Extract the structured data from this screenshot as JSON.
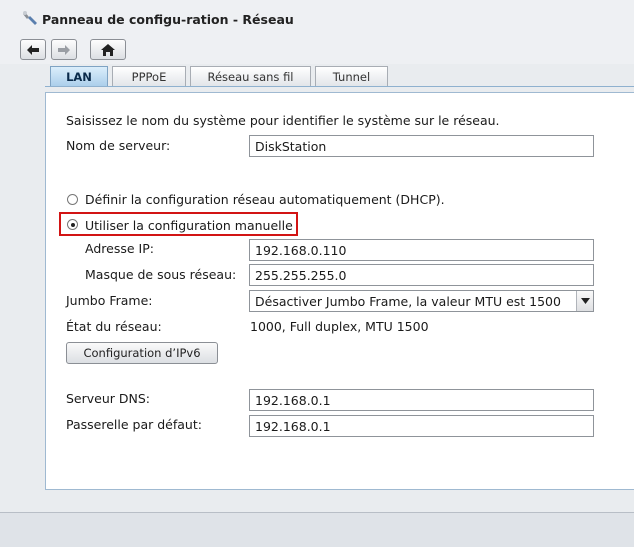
{
  "window": {
    "title": "Panneau de configu-ration - Réseau"
  },
  "nav": {
    "back_icon": "arrow-left-icon",
    "forward_icon": "arrow-right-icon",
    "home_icon": "home-icon"
  },
  "tabs": [
    {
      "label": "LAN",
      "active": true
    },
    {
      "label": "PPPoE",
      "active": false
    },
    {
      "label": "Réseau sans fil",
      "active": false
    },
    {
      "label": "Tunnel",
      "active": false
    }
  ],
  "form": {
    "intro": "Saisissez le nom du système pour identifier le système sur le réseau.",
    "server_name_label": "Nom de serveur:",
    "server_name_value": "DiskStation",
    "dhcp_label": "Définir la configuration réseau automatiquement (DHCP).",
    "manual_label": "Utiliser la configuration manuelle",
    "ip_label": "Adresse IP:",
    "ip_value": "192.168.0.110",
    "mask_label": "Masque de sous réseau:",
    "mask_value": "255.255.255.0",
    "jumbo_label": "Jumbo Frame:",
    "jumbo_value": "Désactiver Jumbo Frame, la valeur MTU est 1500",
    "status_label": "État du réseau:",
    "status_value": "1000, Full duplex, MTU 1500",
    "ipv6_button": "Configuration d’IPv6",
    "dns_label": "Serveur DNS:",
    "dns_value": "192.168.0.1",
    "gateway_label": "Passerelle par défaut:",
    "gateway_value": "192.168.0.1"
  },
  "colors": {
    "highlight": "#d21414",
    "active_tab": "#a9cdea"
  }
}
